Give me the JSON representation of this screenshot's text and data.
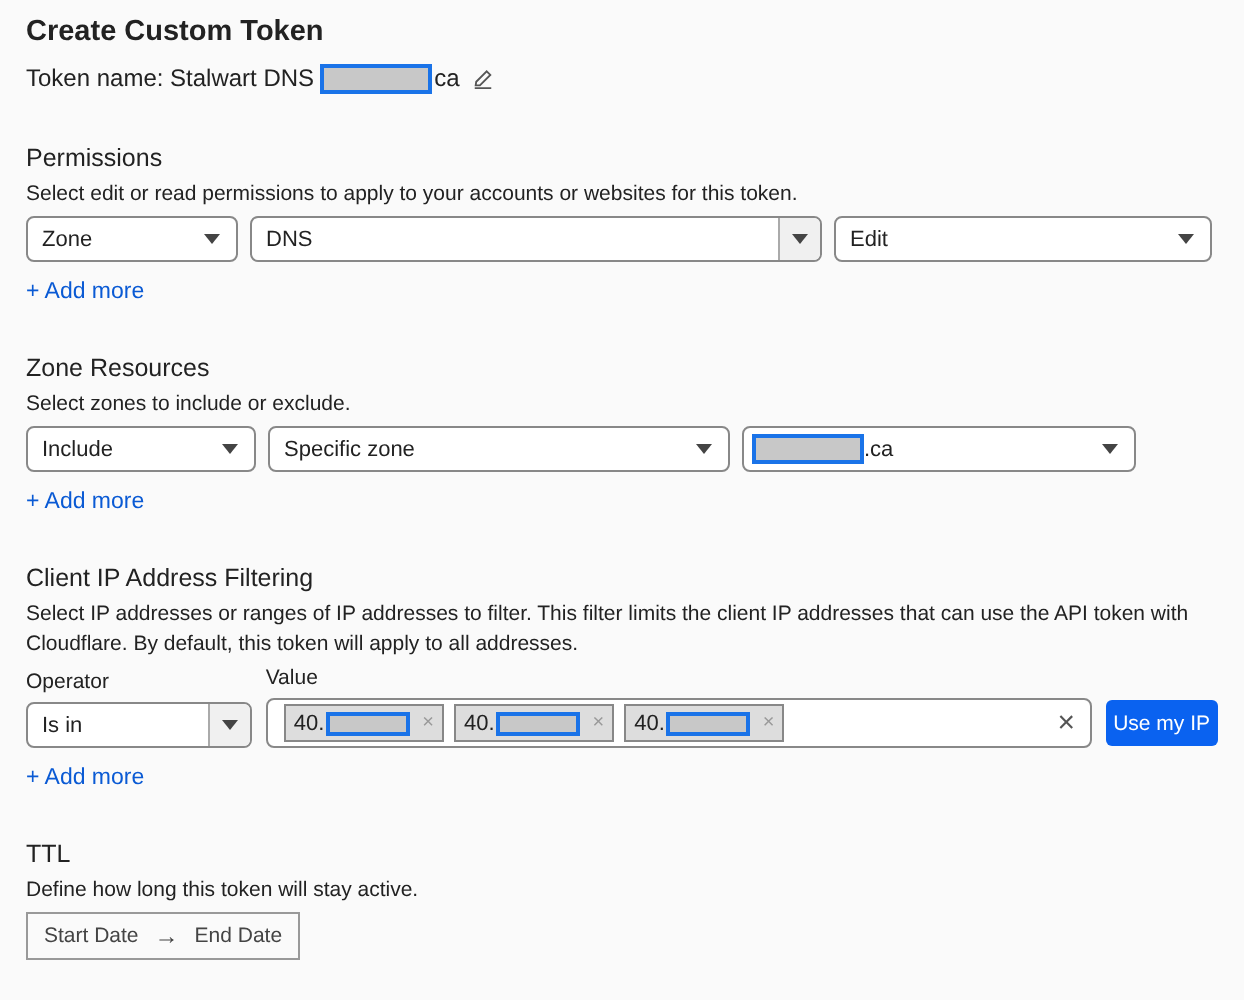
{
  "title": "Create Custom Token",
  "token_name": {
    "label": "Token name: Stalwart DNS",
    "redacted": true,
    "suffix": "ca"
  },
  "permissions": {
    "heading": "Permissions",
    "description": "Select edit or read permissions to apply to your accounts or websites for this token.",
    "selects": [
      {
        "kind": "select",
        "value": "Zone",
        "redacted": false
      },
      {
        "kind": "split",
        "value": "DNS",
        "redacted": false
      },
      {
        "kind": "select",
        "value": "Edit",
        "redacted": false
      }
    ],
    "add_more": "+ Add more"
  },
  "zone_resources": {
    "heading": "Zone Resources",
    "description": "Select zones to include or exclude.",
    "selects": [
      {
        "kind": "select",
        "value": "Include",
        "redacted": false
      },
      {
        "kind": "select",
        "value": "Specific zone",
        "redacted": false
      },
      {
        "kind": "select",
        "value": ".ca",
        "redacted": true
      }
    ],
    "add_more": "+ Add more"
  },
  "client_ip_filtering": {
    "heading": "Client IP Address Filtering",
    "description": "Select IP addresses or ranges of IP addresses to filter. This filter limits the client IP addresses that can use the API token with Cloudflare. By default, this token will apply to all addresses.",
    "operator": {
      "label": "Operator",
      "value": "Is in"
    },
    "value": {
      "label": "Value",
      "tags": [
        {
          "text": "40.",
          "redacted": true,
          "remove": "×"
        },
        {
          "text": "40.",
          "redacted": true,
          "remove": "×"
        },
        {
          "text": "40.",
          "redacted": true,
          "remove": "×"
        }
      ],
      "clear": "×"
    },
    "button": "Use my IP",
    "add_more": "+ Add more"
  },
  "ttl": {
    "heading": "TTL",
    "description": "Define how long this token will stay active.",
    "start": "Start Date",
    "arrow": "→",
    "end": "End Date"
  }
}
